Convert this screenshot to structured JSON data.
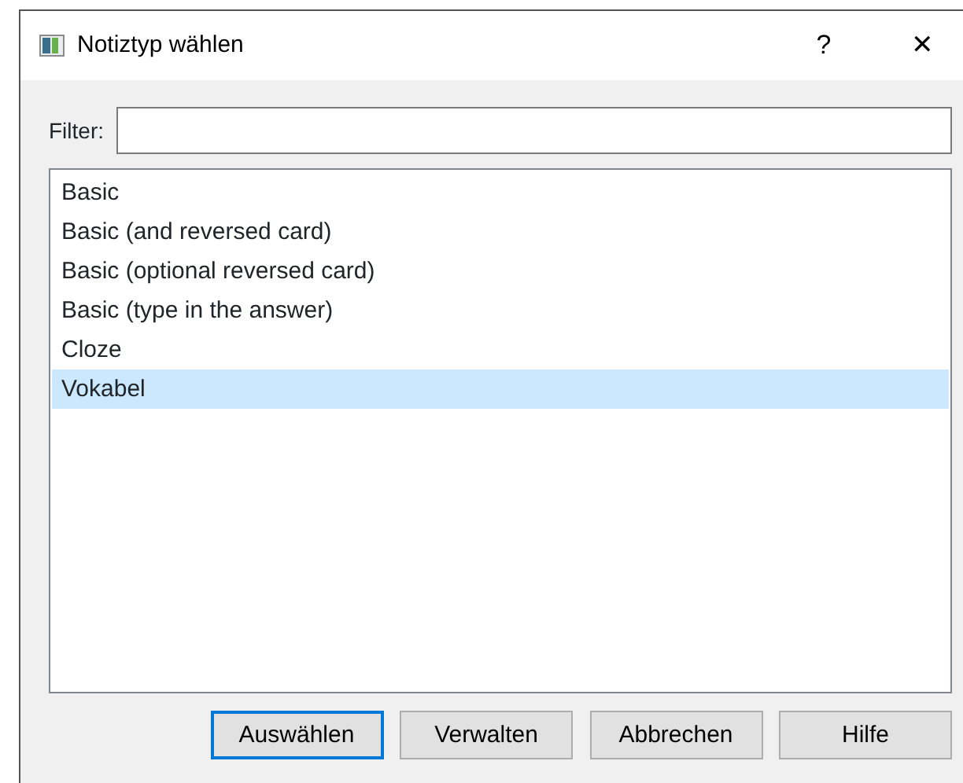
{
  "window": {
    "title": "Notiztyp wählen",
    "help": "?",
    "close": "✕"
  },
  "filter": {
    "label": "Filter:"
  },
  "note_types": [
    {
      "label": "Basic",
      "selected": false
    },
    {
      "label": "Basic (and reversed card)",
      "selected": false
    },
    {
      "label": "Basic (optional reversed card)",
      "selected": false
    },
    {
      "label": "Basic (type in the answer)",
      "selected": false
    },
    {
      "label": "Cloze",
      "selected": false
    },
    {
      "label": "Vokabel",
      "selected": true
    }
  ],
  "buttons": [
    {
      "label": "Auswählen",
      "default": true
    },
    {
      "label": "Verwalten",
      "default": false
    },
    {
      "label": "Abbrechen",
      "default": false
    },
    {
      "label": "Hilfe",
      "default": false
    }
  ]
}
